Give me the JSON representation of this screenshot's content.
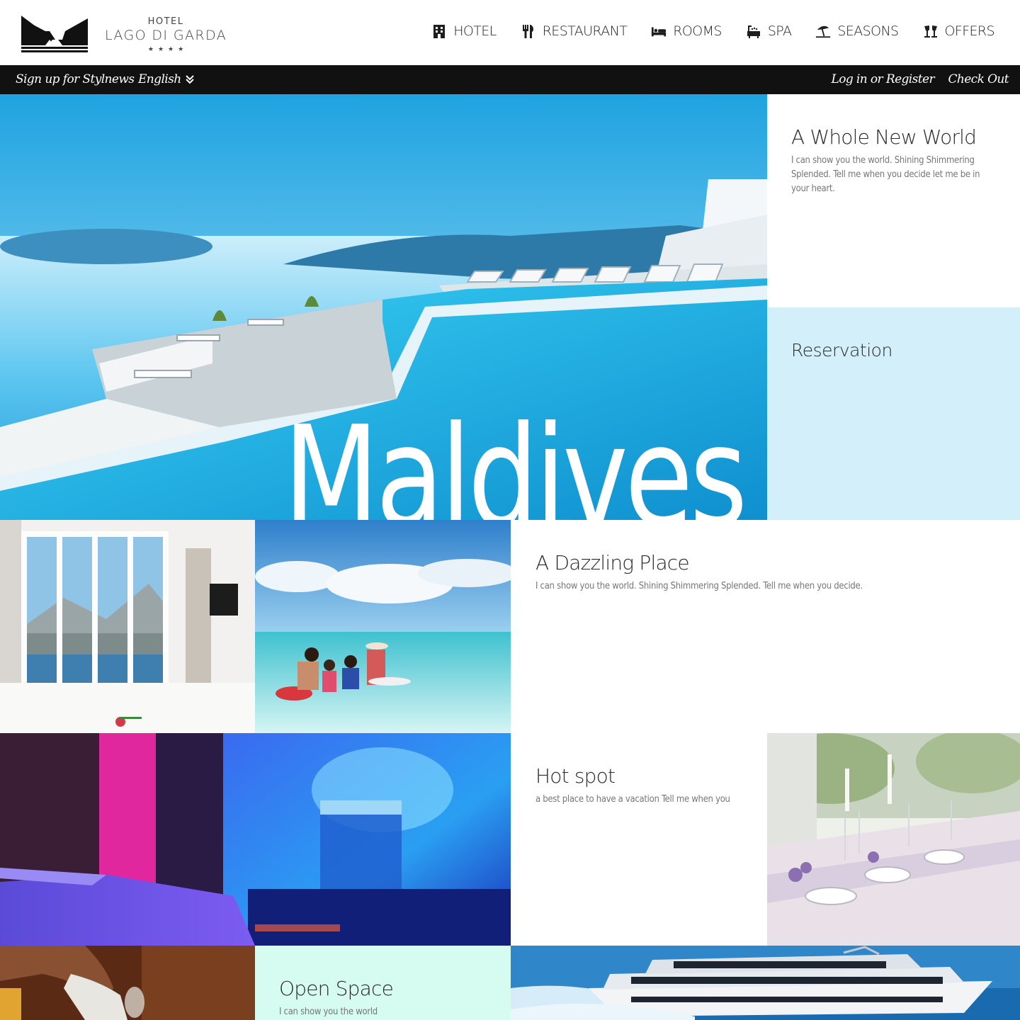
{
  "brand": {
    "small": "HOTEL",
    "name": "LAGO DI GARDA",
    "stars": "★★★★"
  },
  "nav": [
    {
      "label": "HOTEL",
      "icon": "hotel-icon"
    },
    {
      "label": "RESTAURANT",
      "icon": "cutlery-icon"
    },
    {
      "label": "ROOMS",
      "icon": "bed-icon"
    },
    {
      "label": "SPA",
      "icon": "bath-icon"
    },
    {
      "label": "SEASONS",
      "icon": "umbrella-icon"
    },
    {
      "label": "OFFERS",
      "icon": "cheers-icon"
    }
  ],
  "topbar": {
    "signup": "Sign up for Stylnews",
    "language": "English",
    "login": "Log in or Register",
    "checkout": "Check Out"
  },
  "hero": {
    "word": "Maldives"
  },
  "tiles": {
    "world": {
      "title": "A Whole New World",
      "text": "I can show you the world. Shining Shimmering Splended. Tell me when you decide let me be in your heart."
    },
    "reservation": {
      "title": "Reservation"
    },
    "dazzling": {
      "title": "A Dazzling Place",
      "text": "I can show you the world. Shining Shimmering Splended. Tell me when you decide."
    },
    "hotspot": {
      "title": "Hot spot",
      "text": "a best place to have a vacation Tell me when you"
    },
    "open": {
      "title": "Open Space",
      "text": "I can show you the world"
    }
  },
  "colors": {
    "topbar": "#111111",
    "reservation_bg": "#d2effa",
    "open_bg": "#d6fbf1",
    "pool": "#1ec5ef"
  }
}
